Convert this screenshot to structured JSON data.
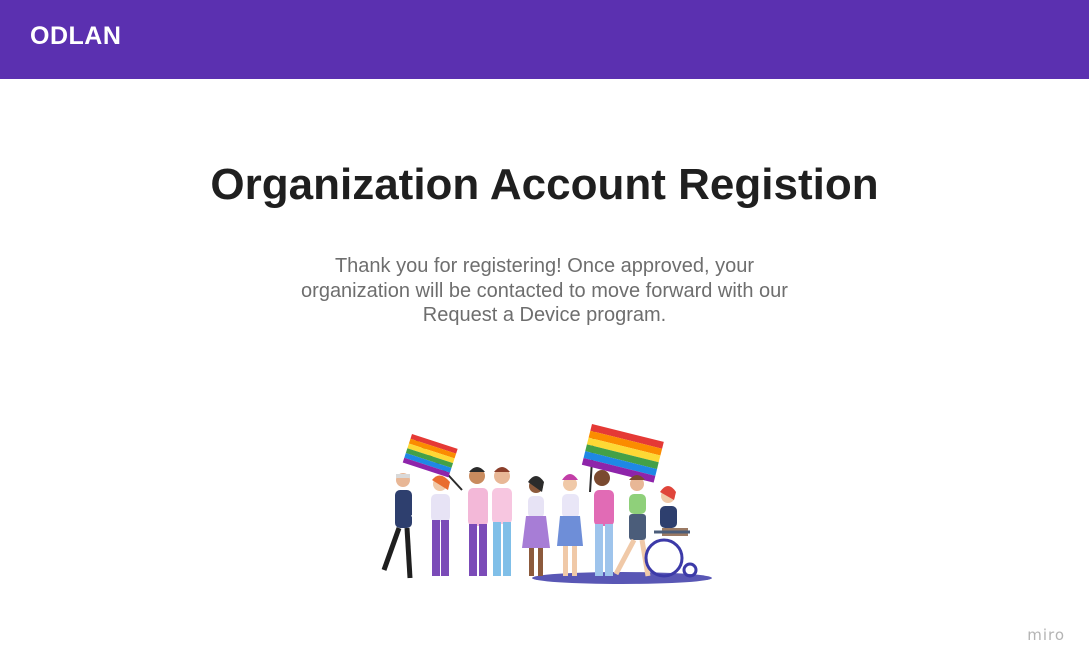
{
  "header": {
    "brand": "ODLAN",
    "background_color": "#5b30b0"
  },
  "main": {
    "title": "Organization Account Registion",
    "message": "Thank you for registering! Once approved, your organization will be contacted to move forward with our Request a Device program.",
    "illustration_icon": "people-with-pride-flags-illustration"
  },
  "footer": {
    "watermark": "miro"
  }
}
